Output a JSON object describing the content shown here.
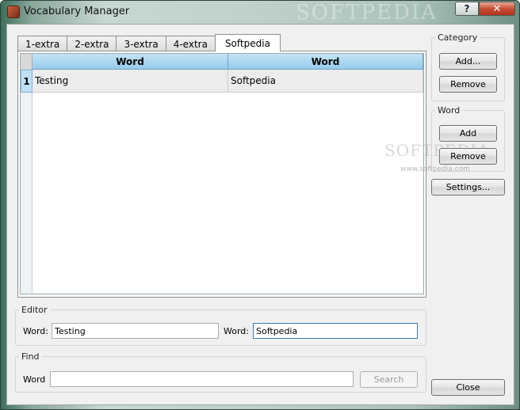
{
  "window": {
    "title": "Vocabulary Manager",
    "title_watermark": "SOFTPEDIA",
    "help_label": "?",
    "close_glyph": "✕"
  },
  "tabs": [
    "1-extra",
    "2-extra",
    "3-extra",
    "4-extra",
    "Softpedia"
  ],
  "active_tab": "Softpedia",
  "grid": {
    "columns": [
      "Word",
      "Word"
    ],
    "rows": [
      {
        "num": "1",
        "cells": [
          "Testing",
          "Softpedia"
        ]
      }
    ]
  },
  "editor": {
    "legend": "Editor",
    "label1": "Word:",
    "value1": "Testing",
    "label2": "Word:",
    "value2": "Softpedia"
  },
  "find": {
    "legend": "Find",
    "label": "Word",
    "value": "",
    "search_label": "Search"
  },
  "category": {
    "legend": "Category",
    "add_label": "Add...",
    "remove_label": "Remove"
  },
  "word": {
    "legend": "Word",
    "add_label": "Add",
    "remove_label": "Remove"
  },
  "settings_label": "Settings...",
  "close_label": "Close",
  "watermark": {
    "main": "SOFTPEDIA",
    "sub": "www.softpedia.com"
  },
  "colors": {
    "header_blue": "#97cbea",
    "close_red": "#c5492f"
  }
}
